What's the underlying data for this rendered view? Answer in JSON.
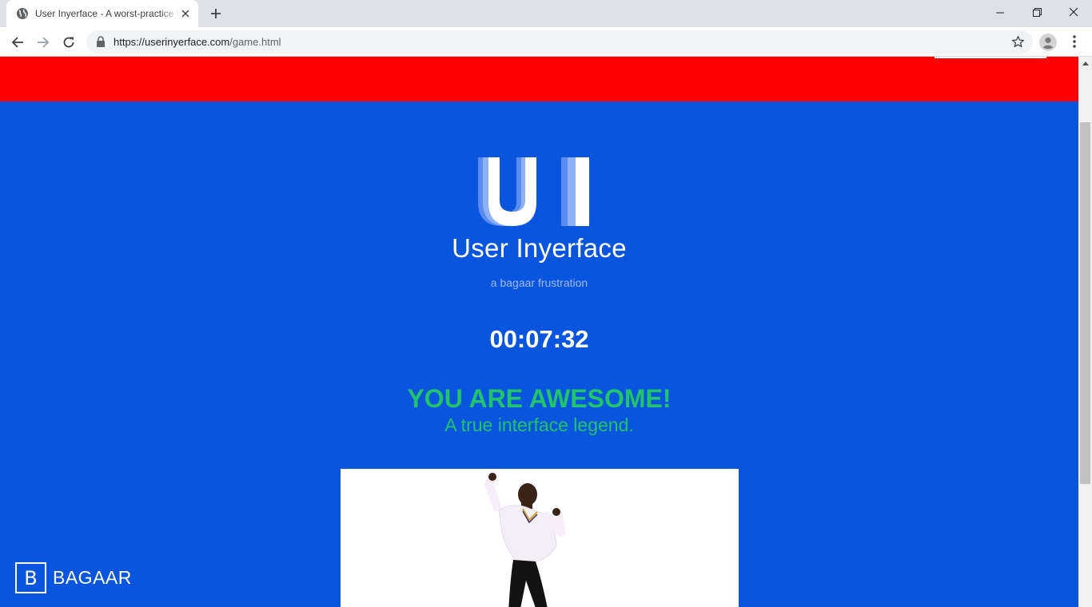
{
  "browser": {
    "tab": {
      "title": "User Inyerface - A worst-practice UI experiment"
    },
    "address_bar": {
      "url_host": "https://userinyerface.com",
      "url_path": "/game.html"
    }
  },
  "page": {
    "brand": {
      "logo_text": "UI",
      "title": "User Inyerface",
      "tagline": "a bagaar frustration"
    },
    "timer": "00:07:32",
    "result": {
      "headline": "YOU ARE AWESOME!",
      "subline": "A true interface legend."
    },
    "footer": {
      "logo_letter": "B",
      "logo_text": "BAGAAR"
    }
  },
  "colors": {
    "page_background": "#0a55dd",
    "top_bar": "#ff0000",
    "success_text": "#21c46a",
    "brand_text": "#ffffff"
  }
}
